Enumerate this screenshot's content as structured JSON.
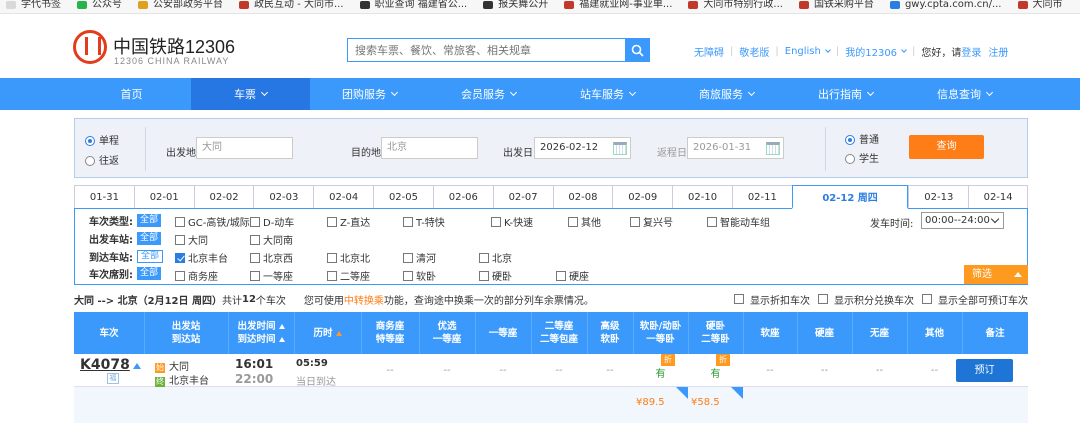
{
  "bookmarks": [
    {
      "label": "学代书签",
      "color": "#d9d9d9"
    },
    {
      "label": "公众号",
      "color": "#27b44b"
    },
    {
      "label": "公安部政务平台",
      "color": "#e0a020"
    },
    {
      "label": "政民互动 - 大同市...",
      "color": "#c0392b"
    },
    {
      "label": "职业查询 福建省公...",
      "color": "#333333"
    },
    {
      "label": "报关舞公开",
      "color": "#333333"
    },
    {
      "label": "福建就业网-事业单...",
      "color": "#c0392b"
    },
    {
      "label": "大同市特别行政...",
      "color": "#c0392b"
    },
    {
      "label": "国铁采购平台",
      "color": "#c0392b"
    },
    {
      "label": "gwy.cpta.com.cn/...",
      "color": "#2a7ee3"
    },
    {
      "label": "大同市",
      "color": "#c0392b"
    }
  ],
  "header": {
    "brand": "中国铁路12306",
    "brand_sub": "12306 CHINA RAILWAY",
    "search_placeholder": "搜索车票、餐饮、常旅客、相关规章",
    "links": {
      "accessibility": "无障碍",
      "elderly": "敬老版",
      "language": "English",
      "my12306": "我的12306",
      "greeting": "您好，请",
      "login": "登录",
      "register": "注册"
    }
  },
  "nav": [
    "首页",
    "车票",
    "团购服务",
    "会员服务",
    "站车服务",
    "商旅服务",
    "出行指南",
    "信息查询"
  ],
  "query": {
    "one_way": "单程",
    "round_trip": "往返",
    "from_label": "出发地",
    "from_value": "大同",
    "to_label": "目的地",
    "to_value": "北京",
    "depart_label": "出发日",
    "depart_value": "2026-02-12",
    "return_label": "返程日",
    "return_value": "2026-01-31",
    "normal": "普通",
    "student": "学生",
    "search_btn": "查询"
  },
  "dates": [
    "01-31",
    "02-01",
    "02-02",
    "02-03",
    "02-04",
    "02-05",
    "02-06",
    "02-07",
    "02-08",
    "02-09",
    "02-10",
    "02-11",
    "02-12 周四",
    "02-13",
    "02-14"
  ],
  "filters": {
    "type_label": "车次类型:",
    "depart_station_label": "出发车站:",
    "arrive_station_label": "到达车站:",
    "seat_label": "车次席别:",
    "all": "全部",
    "types": [
      "GC-高铁/城际",
      "D-动车",
      "Z-直达",
      "T-特快",
      "K-快速",
      "其他",
      "复兴号",
      "智能动车组"
    ],
    "depart_stations": [
      "大同",
      "大同南"
    ],
    "arrive_stations": [
      "北京丰台",
      "北京西",
      "北京北",
      "清河",
      "北京"
    ],
    "seats": [
      "商务座",
      "一等座",
      "二等座",
      "软卧",
      "硬卧",
      "硬座"
    ],
    "time_label": "发车时间:",
    "time_value": "00:00--24:00",
    "filter_btn": "筛选"
  },
  "summary": {
    "route": "大同 --> 北京（2月12日  周四）",
    "count_prefix": "共计",
    "count": "12",
    "count_suffix": "个车次",
    "note_pre": "您可使用",
    "note_link": "中转换乘",
    "note_post": "功能，查询途中换乘一次的部分列车余票情况。",
    "opt1": "显示折扣车次",
    "opt2": "显示积分兑换车次",
    "opt3": "显示全部可预订车次"
  },
  "table_header": {
    "train": "车次",
    "stations": [
      "出发站",
      "到达站"
    ],
    "times": [
      "出发时间",
      "到达时间"
    ],
    "duration": "历时",
    "business": [
      "商务座",
      "特等座"
    ],
    "premium": [
      "优选",
      "一等座"
    ],
    "first": "一等座",
    "second": [
      "二等座",
      "二等包座"
    ],
    "high_soft": [
      "高级",
      "软卧"
    ],
    "soft_sleeper": [
      "软卧/动卧",
      "一等卧"
    ],
    "hard_sleeper": [
      "硬卧",
      "二等卧"
    ],
    "soft_seat": "软座",
    "hard_seat": "硬座",
    "no_seat": "无座",
    "other": "其他",
    "remark": "备注"
  },
  "train": {
    "number": "K4078",
    "fuxing": "福",
    "from_tag": "始",
    "to_tag": "终",
    "from": "大同",
    "to": "北京丰台",
    "depart": "16:01",
    "arrive": "22:00",
    "duration": "05:59",
    "arrive_day": "当日到达",
    "dash": "--",
    "has": "有",
    "discount": "折",
    "soft_price": "¥89.5",
    "hard_price": "¥58.5",
    "book": "预订"
  }
}
